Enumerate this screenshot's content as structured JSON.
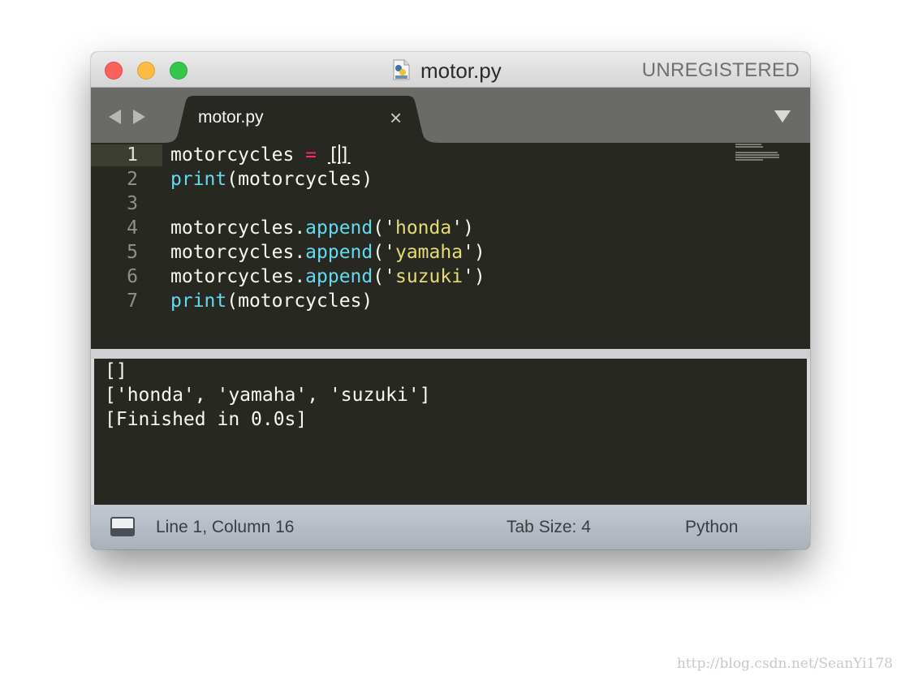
{
  "window": {
    "title": "motor.py",
    "registration": "UNREGISTERED"
  },
  "tabs": [
    {
      "label": "motor.py",
      "close_glyph": "×",
      "active": true
    }
  ],
  "editor": {
    "lines": [
      {
        "number": "1",
        "text": "motorcycles = []"
      },
      {
        "number": "2",
        "text": "print(motorcycles)"
      },
      {
        "number": "3",
        "text": ""
      },
      {
        "number": "4",
        "text": "motorcycles.append('honda')"
      },
      {
        "number": "5",
        "text": "motorcycles.append('yamaha')"
      },
      {
        "number": "6",
        "text": "motorcycles.append('suzuki')"
      },
      {
        "number": "7",
        "text": "print(motorcycles)"
      }
    ],
    "active_line": 1
  },
  "output": {
    "lines": [
      "[]",
      "['honda', 'yamaha', 'suzuki']",
      "[Finished in 0.0s]"
    ]
  },
  "statusbar": {
    "position": "Line 1, Column 16",
    "tab_size": "Tab Size: 4",
    "syntax": "Python"
  },
  "watermark": "http://blog.csdn.net/SeanYi178",
  "colors": {
    "editor_bg": "#272822",
    "keyword": "#f92672",
    "function": "#66d9ef",
    "string": "#e6db74",
    "text": "#f8f8f2"
  },
  "icons": {
    "traffic_lights": [
      "close-icon",
      "minimize-icon",
      "maximize-icon"
    ],
    "file": "python-file-icon",
    "nav": [
      "arrow-left-icon",
      "arrow-right-icon"
    ],
    "tab_menu": "chevron-down-icon",
    "panel": "panel-toggle-icon"
  }
}
